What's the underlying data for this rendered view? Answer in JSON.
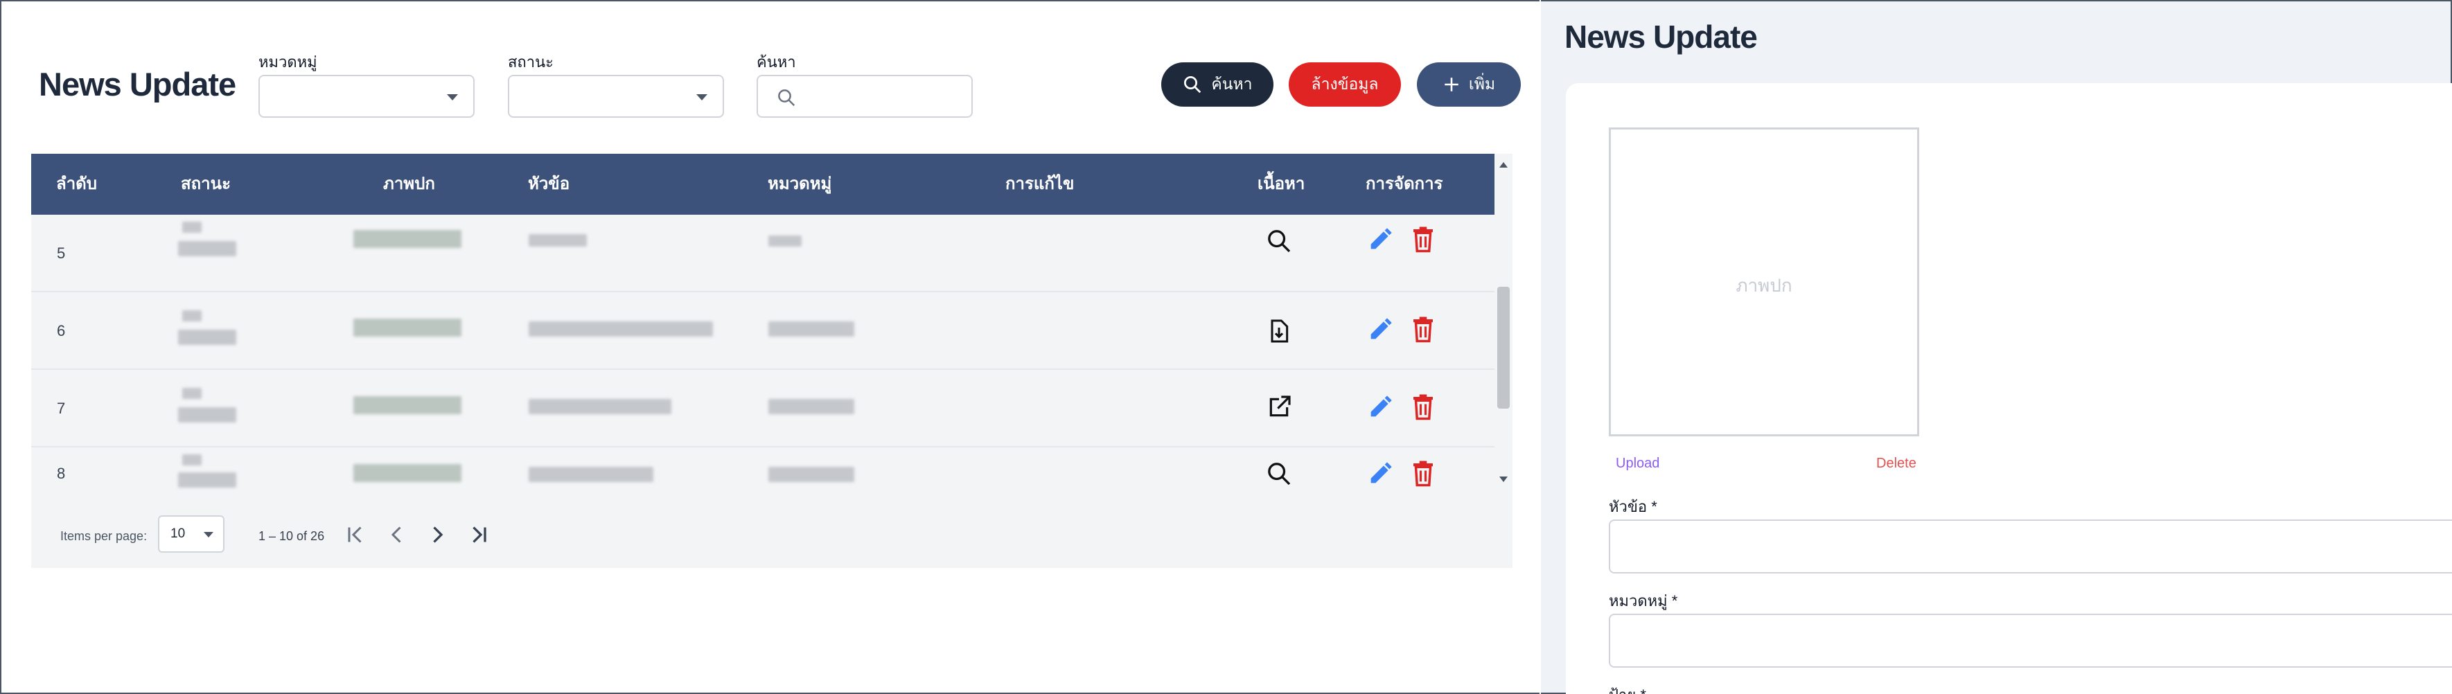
{
  "header": {
    "title": "News Update",
    "filters": {
      "category_label": "หมวดหมู่",
      "status_label": "สถานะ",
      "search_label": "ค้นหา"
    },
    "buttons": {
      "search": "ค้นหา",
      "clear": "ล้างข้อมูล",
      "add": "เพิ่ม"
    }
  },
  "table": {
    "columns": [
      "ลำดับ",
      "สถานะ",
      "ภาพปก",
      "หัวข้อ",
      "หมวดหมู่",
      "การแก้ไข",
      "เนื้อหา",
      "การจัดการ"
    ],
    "rows": [
      {
        "index": "5",
        "content_icon": "search-icon"
      },
      {
        "index": "6",
        "content_icon": "file-download-icon"
      },
      {
        "index": "7",
        "content_icon": "external-link-icon"
      },
      {
        "index": "8",
        "content_icon": "search-icon"
      }
    ]
  },
  "paginator": {
    "items_per_page_label": "Items per page:",
    "page_size": "10",
    "range": "1 – 10 of 26"
  },
  "form": {
    "title": "News Update",
    "cover_placeholder": "ภาพปก",
    "upload_label": "Upload",
    "delete_label": "Delete",
    "title_label": "หัวข้อ *",
    "category_label": "หมวดหมู่ *",
    "tag_label": "ป้าย *"
  },
  "colors": {
    "header_bg": "#3d527a",
    "dark_button": "#1e2a3b",
    "danger": "#e02424",
    "edit_icon": "#3b82f6",
    "delete_icon": "#dc2626"
  }
}
